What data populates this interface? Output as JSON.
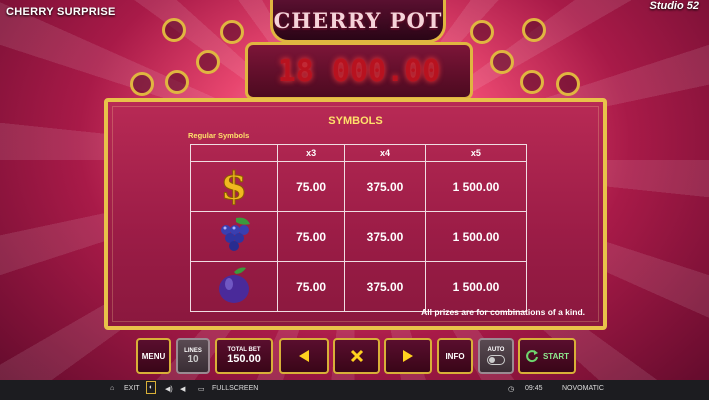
{
  "header": {
    "game_name": "CHERRY SURPRISE",
    "studio": "Studio 52",
    "logo_text": "CHERRY POT",
    "jackpot_value": "18 000.00"
  },
  "paytable": {
    "title": "SYMBOLS",
    "section_label": "Regular Symbols",
    "columns": [
      "",
      "x3",
      "x4",
      "x5"
    ],
    "rows": [
      {
        "symbol": "dollar-icon",
        "values": [
          "75.00",
          "375.00",
          "1 500.00"
        ]
      },
      {
        "symbol": "grapes-icon",
        "values": [
          "75.00",
          "375.00",
          "1 500.00"
        ]
      },
      {
        "symbol": "plum-icon",
        "values": [
          "75.00",
          "375.00",
          "1 500.00"
        ]
      }
    ],
    "note": "All prizes are for combinations of a kind."
  },
  "controls": {
    "menu_label": "MENU",
    "lines_label": "LINES",
    "lines_value": "10",
    "total_bet_label": "TOTAL BET",
    "total_bet_value": "150.00",
    "info_label": "INFO",
    "auto_label": "AUTO",
    "start_label": "START"
  },
  "footer": {
    "exit_label": "EXIT",
    "fullscreen_label": "FULLSCREEN",
    "time": "09:45",
    "provider": "NOVOMATIC"
  },
  "colors": {
    "gold": "#e0b640",
    "panel": "#9b1c46",
    "accent_yellow": "#ffe16b",
    "start_green": "#6ed66e"
  }
}
